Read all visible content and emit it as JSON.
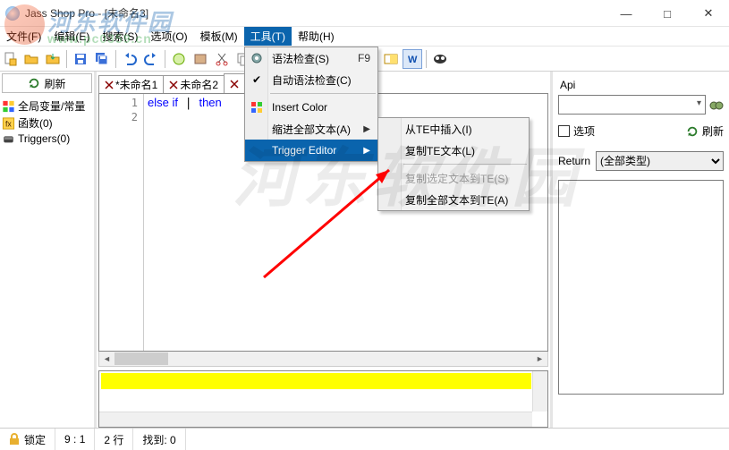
{
  "window": {
    "title": "Jass Shop Pro - [未命名3]",
    "min": "—",
    "max": "□",
    "close": "✕"
  },
  "menubar": {
    "file": "文件(F)",
    "edit": "编辑(E)",
    "search": "搜索(S)",
    "options": "选项(O)",
    "template": "模板(M)",
    "tools": "工具(T)",
    "help": "帮助(H)"
  },
  "tools_menu": {
    "syntax_check": "语法检查(S)",
    "syntax_check_key": "F9",
    "auto_syntax": "自动语法检查(C)",
    "insert_color": "Insert Color",
    "indent_all": "缩进全部文本(A)",
    "trigger_editor": "Trigger Editor"
  },
  "te_submenu": {
    "insert_from_te": "从TE中插入(I)",
    "copy_te_text": "复制TE文本(L)",
    "copy_sel_to_te": "复制选定文本到TE(S)",
    "copy_all_to_te": "复制全部文本到TE(A)"
  },
  "left": {
    "refresh": "刷新",
    "globals": "全局变量/常量",
    "functions": "函数(0)",
    "triggers": "Triggers(0)"
  },
  "tabs": {
    "t1": "*未命名1",
    "t2": "未命名2",
    "t3": ""
  },
  "code": {
    "line1_a": "else if",
    "line1_b": "then"
  },
  "right": {
    "api": "Api",
    "option": "选项",
    "refresh": "刷新",
    "return": "Return",
    "return_val": "(全部类型)"
  },
  "status": {
    "lock": "锁定",
    "pos": "9 : 1",
    "lines": "2 行",
    "found": "找到: 0"
  },
  "watermark": {
    "site": "河东软件园",
    "url": "www.pc0359.cn",
    "big": "河东软件园"
  }
}
